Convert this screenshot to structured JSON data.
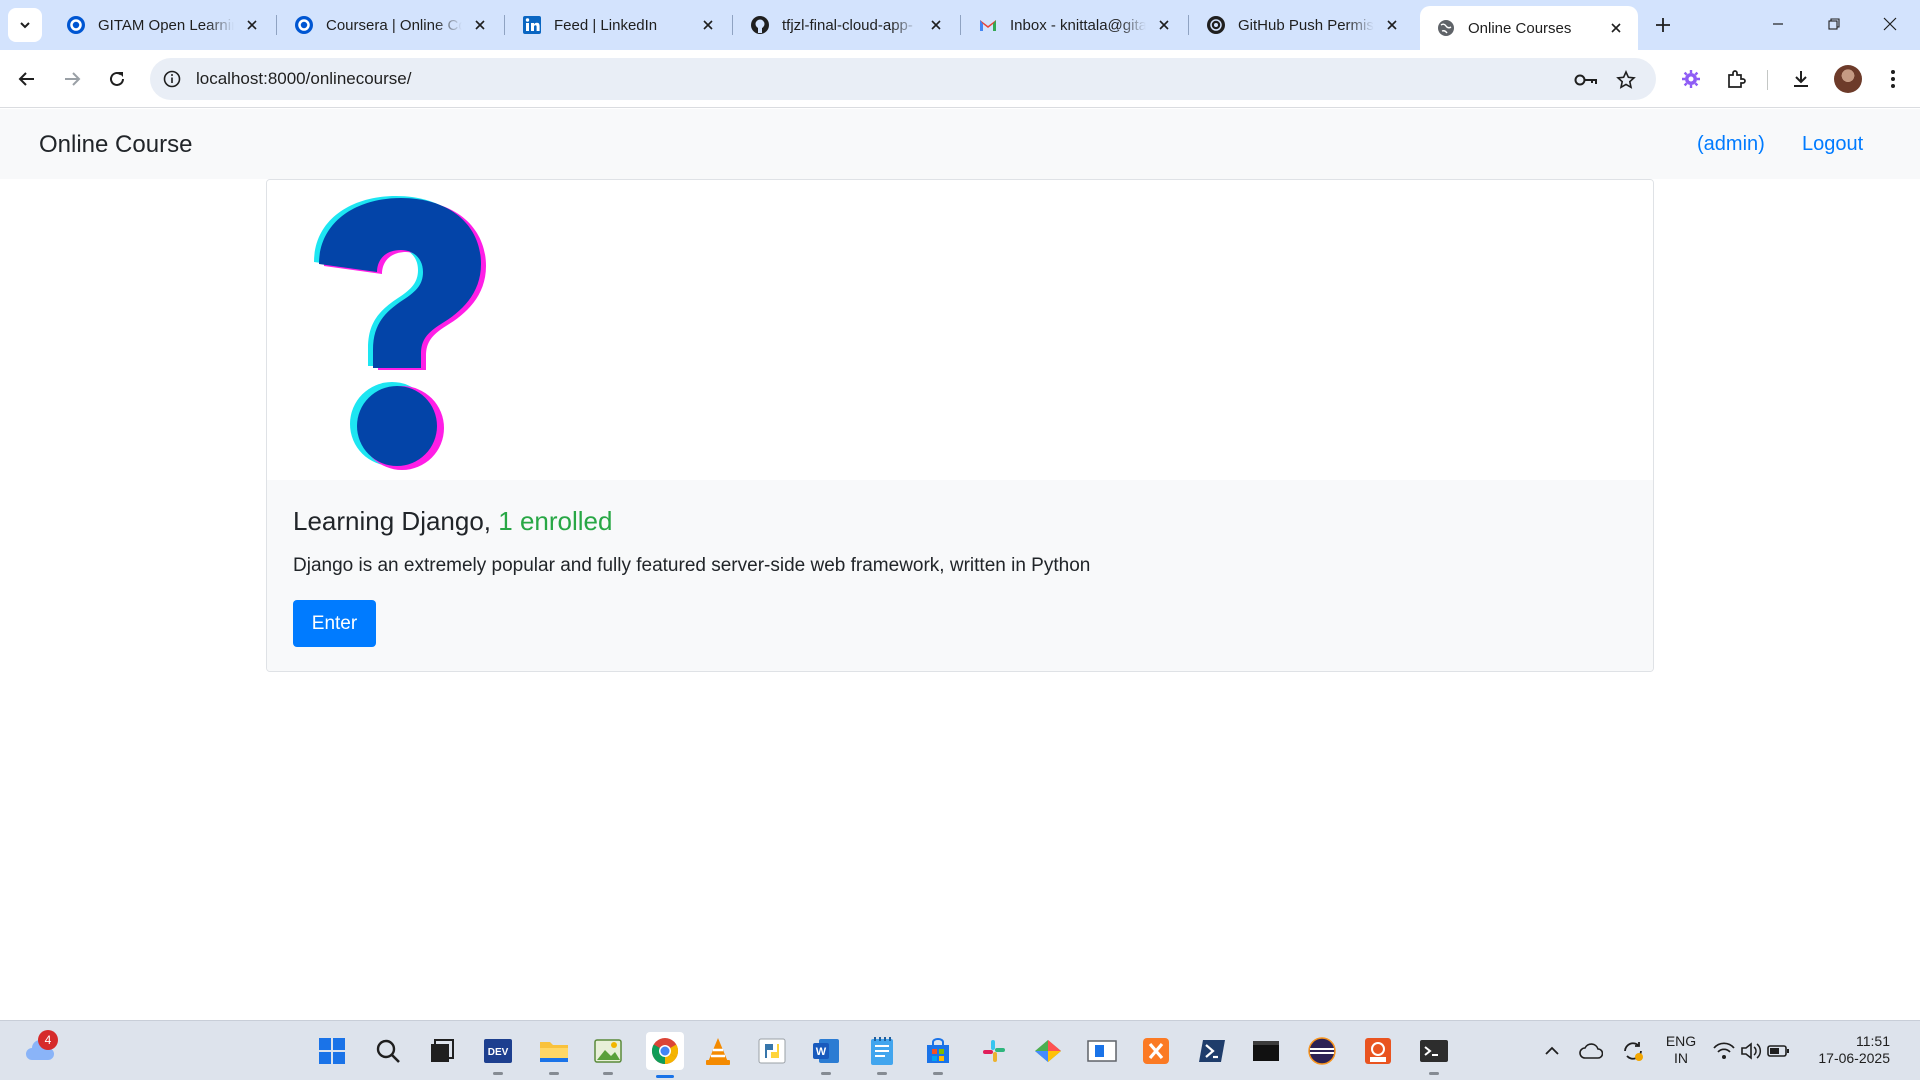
{
  "browser": {
    "tabs": [
      {
        "title": "GITAM Open Learning",
        "icon": "coursera-icon"
      },
      {
        "title": "Coursera | Online Courses",
        "icon": "coursera-icon"
      },
      {
        "title": "Feed | LinkedIn",
        "icon": "linkedin-icon"
      },
      {
        "title": "tfjzl-final-cloud-app-",
        "icon": "github-icon"
      },
      {
        "title": "Inbox - knittala@gitam",
        "icon": "gmail-icon"
      },
      {
        "title": "GitHub Push Permissions",
        "icon": "openai-icon"
      },
      {
        "title": "Online Courses",
        "icon": "globe-icon",
        "active": true
      }
    ],
    "url": "localhost:8000/onlinecourse/"
  },
  "navbar": {
    "brand": "Online Course",
    "user_link": "(admin)",
    "logout_link": "Logout"
  },
  "course": {
    "title": "Learning Django,",
    "enrolled": "1 enrolled",
    "description": "Django is an extremely popular and fully featured server-side web framework, written in Python",
    "enter_label": "Enter",
    "image_icon": "question-mark-icon",
    "colors": {
      "primary": "#007bff",
      "enrolled": "#28a745",
      "qmark": "#0344a8"
    }
  },
  "taskbar": {
    "weather_badge": "4",
    "language": "ENG",
    "region": "IN",
    "time": "11:51",
    "date": "17-06-2025"
  }
}
